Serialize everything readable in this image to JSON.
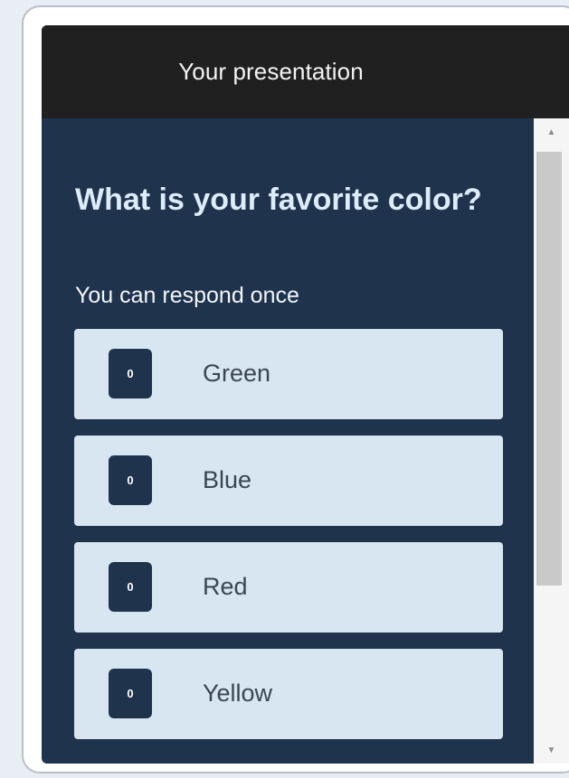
{
  "header": {
    "title": "Your presentation"
  },
  "poll": {
    "question": "What is your favorite color?",
    "instruction": "You can respond once",
    "options": [
      {
        "label": "Green",
        "count": "0"
      },
      {
        "label": "Blue",
        "count": "0"
      },
      {
        "label": "Red",
        "count": "0"
      },
      {
        "label": "Yellow",
        "count": "0"
      }
    ]
  },
  "scrollbar": {
    "up_icon": "scroll-up-arrow",
    "down_icon": "scroll-down-arrow",
    "up_glyph": "▲",
    "down_glyph": "▼"
  },
  "colors": {
    "panel": "#1f334d",
    "header": "#202020",
    "option_bg": "#d8e6f2",
    "question_text": "#dcecfa"
  }
}
